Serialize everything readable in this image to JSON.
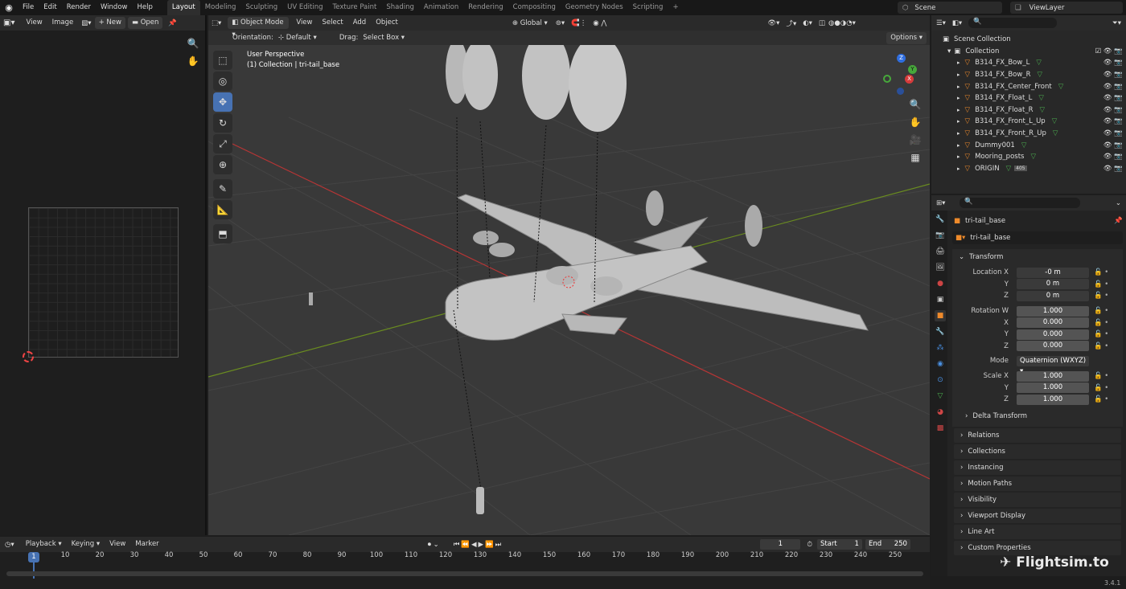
{
  "topbar": {
    "menus": [
      "File",
      "Edit",
      "Render",
      "Window",
      "Help"
    ],
    "workspaces": [
      "Layout",
      "Modeling",
      "Sculpting",
      "UV Editing",
      "Texture Paint",
      "Shading",
      "Animation",
      "Rendering",
      "Compositing",
      "Geometry Nodes",
      "Scripting"
    ],
    "active_workspace": "Layout",
    "add_tab": "+",
    "scene": "Scene",
    "view_layer": "ViewLayer"
  },
  "image_editor": {
    "view": "View",
    "image": "Image",
    "new": "New",
    "open": "Open"
  },
  "viewport": {
    "mode": "Object Mode",
    "menus": [
      "View",
      "Select",
      "Add",
      "Object"
    ],
    "transform_orientation": "Global",
    "orientation_label": "Orientation:",
    "orientation_value": "Default",
    "drag_label": "Drag:",
    "drag_value": "Select Box",
    "options": "Options",
    "overlay_title": "User Perspective",
    "overlay_subtitle": "(1) Collection | tri-tail_base",
    "gizmo": {
      "x": "X",
      "y": "Y",
      "z": "Z"
    }
  },
  "outliner": {
    "root": "Scene Collection",
    "collection": "Collection",
    "items": [
      "B314_FX_Bow_L",
      "B314_FX_Bow_R",
      "B314_FX_Center_Front",
      "B314_FX_Float_L",
      "B314_FX_Float_R",
      "B314_FX_Front_L_Up",
      "B314_FX_Front_R_Up",
      "Dummy001",
      "Mooring_posts",
      "ORIGIN"
    ],
    "origin_badge": "405"
  },
  "properties": {
    "object_name": "tri-tail_base",
    "data_name": "tri-tail_base",
    "transform_header": "Transform",
    "location": {
      "label": "Location X",
      "x": "-0 m",
      "y": "0 m",
      "z": "0 m"
    },
    "rotation": {
      "label": "Rotation W",
      "w": "1.000",
      "x": "0.000",
      "y": "0.000",
      "z": "0.000"
    },
    "mode_label": "Mode",
    "mode_value": "Quaternion (WXYZ)",
    "scale": {
      "label": "Scale X",
      "x": "1.000",
      "y": "1.000",
      "z": "1.000"
    },
    "axis_labels": {
      "x": "X",
      "y": "Y",
      "z": "Z",
      "w": "W"
    },
    "delta_transform": "Delta Transform",
    "panels": [
      "Relations",
      "Collections",
      "Instancing",
      "Motion Paths",
      "Visibility",
      "Viewport Display",
      "Line Art",
      "Custom Properties"
    ]
  },
  "timeline": {
    "menus": [
      "Playback",
      "Keying",
      "View",
      "Marker"
    ],
    "current_frame": "1",
    "start_label": "Start",
    "start": "1",
    "end_label": "End",
    "end": "250",
    "ticks": [
      "10",
      "20",
      "30",
      "40",
      "50",
      "60",
      "70",
      "80",
      "90",
      "100",
      "110",
      "120",
      "130",
      "140",
      "150",
      "160",
      "170",
      "180",
      "190",
      "200",
      "210",
      "220",
      "230",
      "240",
      "250"
    ],
    "current_marker": "1"
  },
  "watermark": "Flightsim.to",
  "version": "3.4.1"
}
